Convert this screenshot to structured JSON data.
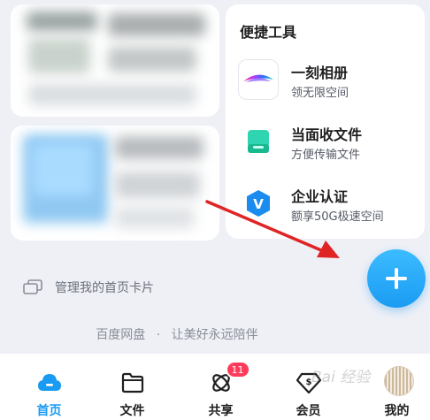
{
  "tools": {
    "title": "便捷工具",
    "items": [
      {
        "name": "一刻相册",
        "desc": "领无限空间",
        "icon": "album-rainbow-icon"
      },
      {
        "name": "当面收文件",
        "desc": "方便传输文件",
        "icon": "receive-file-icon"
      },
      {
        "name": "企业认证",
        "desc": "额享50G极速空间",
        "icon": "enterprise-verify-icon"
      }
    ]
  },
  "manage": {
    "label": "管理我的首页卡片"
  },
  "slogan": {
    "brand": "百度网盘",
    "separator": "·",
    "text": "让美好永远陪伴"
  },
  "tabs": [
    {
      "label": "首页",
      "icon": "home-cloud-icon",
      "active": true
    },
    {
      "label": "文件",
      "icon": "folder-icon"
    },
    {
      "label": "共享",
      "icon": "share-orbit-icon",
      "badge": "11"
    },
    {
      "label": "会员",
      "icon": "vip-diamond-icon"
    },
    {
      "label": "我的",
      "icon": "avatar"
    }
  ],
  "watermark": {
    "text": "Bai 经验"
  },
  "colors": {
    "accent": "#1a9bf2",
    "badge": "#ff3b5c",
    "arrow": "#e02424"
  }
}
